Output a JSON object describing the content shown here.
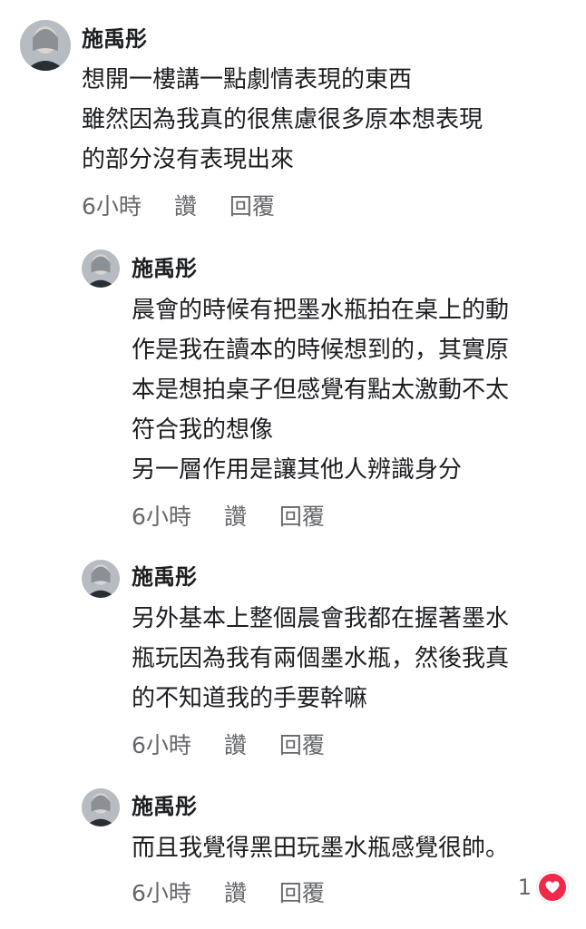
{
  "comments": [
    {
      "author": "施禹彤",
      "text": "想開一樓講一點劇情表現的東西\n雖然因為我真的很焦慮很多原本想表現\n的部分沒有表現出來",
      "time": "6小時",
      "like": "讚",
      "reply": "回覆"
    },
    {
      "author": "施禹彤",
      "text": "晨會的時候有把墨水瓶拍在桌上的動\n作是我在讀本的時候想到的，其實原\n本是想拍桌子但感覺有點太激動不太\n符合我的想像\n另一層作用是讓其他人辨識身分",
      "time": "6小時",
      "like": "讚",
      "reply": "回覆"
    },
    {
      "author": "施禹彤",
      "text": "另外基本上整個晨會我都在握著墨水\n瓶玩因為我有兩個墨水瓶，然後我真\n的不知道我的手要幹嘛",
      "time": "6小時",
      "like": "讚",
      "reply": "回覆"
    },
    {
      "author": "施禹彤",
      "text": "而且我覺得黑田玩墨水瓶感覺很帥。",
      "time": "6小時",
      "like": "讚",
      "reply": "回覆",
      "reaction_count": "1",
      "reaction_icon": "heart-icon"
    }
  ],
  "colors": {
    "text": "#1c1e21",
    "meta": "#65676b",
    "heart": "#f0284a"
  }
}
